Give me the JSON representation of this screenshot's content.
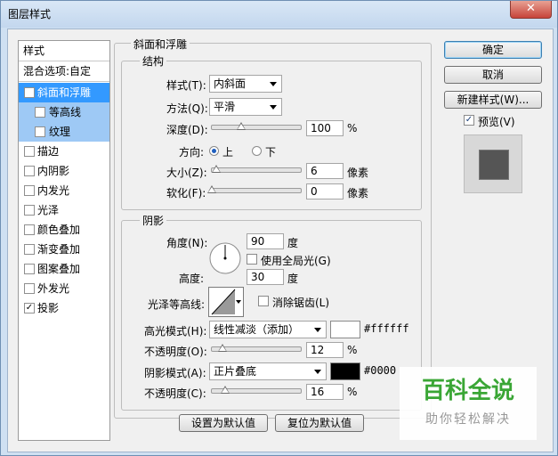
{
  "window": {
    "title": "图层样式",
    "close_glyph": "✕"
  },
  "list": {
    "header": "样式",
    "blend": "混合选项:自定",
    "items": [
      {
        "label": "斜面和浮雕",
        "checked": true,
        "selected": true
      },
      {
        "label": "等高线",
        "checked": false,
        "sub": true
      },
      {
        "label": "纹理",
        "checked": false,
        "sub": true
      },
      {
        "label": "描边",
        "checked": false
      },
      {
        "label": "内阴影",
        "checked": false
      },
      {
        "label": "内发光",
        "checked": false
      },
      {
        "label": "光泽",
        "checked": false
      },
      {
        "label": "颜色叠加",
        "checked": false
      },
      {
        "label": "渐变叠加",
        "checked": false
      },
      {
        "label": "图案叠加",
        "checked": false
      },
      {
        "label": "外发光",
        "checked": false
      },
      {
        "label": "投影",
        "checked": true
      }
    ]
  },
  "bevel": {
    "group_title": "斜面和浮雕",
    "structure_title": "结构",
    "style_label": "样式(T):",
    "style_value": "内斜面",
    "method_label": "方法(Q):",
    "method_value": "平滑",
    "depth_label": "深度(D):",
    "depth_value": "100",
    "depth_unit": "%",
    "direction_label": "方向:",
    "dir_up": "上",
    "dir_down": "下",
    "size_label": "大小(Z):",
    "size_value": "6",
    "size_unit": "像素",
    "soften_label": "软化(F):",
    "soften_value": "0",
    "soften_unit": "像素"
  },
  "shading": {
    "title": "阴影",
    "angle_label": "角度(N):",
    "angle_value": "90",
    "angle_unit": "度",
    "global_light": "使用全局光(G)",
    "altitude_label": "高度:",
    "altitude_value": "30",
    "altitude_unit": "度",
    "gloss_label": "光泽等高线:",
    "antialias": "消除锯齿(L)",
    "highlight_label": "高光模式(H):",
    "highlight_mode": "线性减淡（添加）",
    "highlight_color": "#ffffff",
    "opacity1_label": "不透明度(O):",
    "opacity1_value": "12",
    "opacity_unit": "%",
    "shadow_label": "阴影模式(A):",
    "shadow_mode": "正片叠底",
    "shadow_color_text": "#0000",
    "opacity2_label": "不透明度(C):",
    "opacity2_value": "16",
    "default_btn": "设置为默认值",
    "reset_btn": "复位为默认值"
  },
  "right": {
    "ok": "确定",
    "cancel": "取消",
    "new_style": "新建样式(W)...",
    "preview": "预览(V)"
  },
  "watermark": {
    "title": "百科全说",
    "subtitle": "助你轻松解决"
  },
  "colors": {
    "selected": "#3399ff",
    "sub_selected": "#9ec9f5",
    "highlight_swatch": "#ffffff",
    "shadow_swatch": "#000000",
    "preview_square": "#555555",
    "watermark_green": "#3aa635"
  }
}
